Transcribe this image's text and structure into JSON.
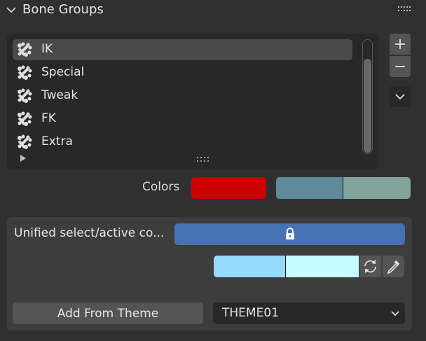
{
  "panel": {
    "title": "Bone Groups"
  },
  "bone_groups": {
    "items": [
      {
        "label": "IK",
        "active": true,
        "icon": "bone-group-icon"
      },
      {
        "label": "Special",
        "active": false,
        "icon": "bone-group-icon"
      },
      {
        "label": "Tweak",
        "active": false,
        "icon": "bone-group-icon"
      },
      {
        "label": "FK",
        "active": false,
        "icon": "bone-group-icon"
      },
      {
        "label": "Extra",
        "active": false,
        "icon": "bone-group-icon"
      }
    ]
  },
  "side_buttons": {
    "add_icon": "plus-icon",
    "remove_icon": "minus-icon",
    "menu_icon": "chevron-down-icon"
  },
  "colors": {
    "label": "Colors",
    "normal": "#cc0000",
    "select": "#5f8a9b",
    "active": "#80a39b"
  },
  "unified": {
    "label": "Unified select/active co...",
    "toggle_icon": "lock-icon",
    "toggle_color": "#4772b3",
    "picker_a": "#96daff",
    "picker_b": "#c6fcff",
    "swap_icon": "swap-icon",
    "eyedropper_icon": "eyedropper-icon"
  },
  "theme": {
    "button_label": "Add From Theme",
    "selected_value": "THEME01"
  }
}
